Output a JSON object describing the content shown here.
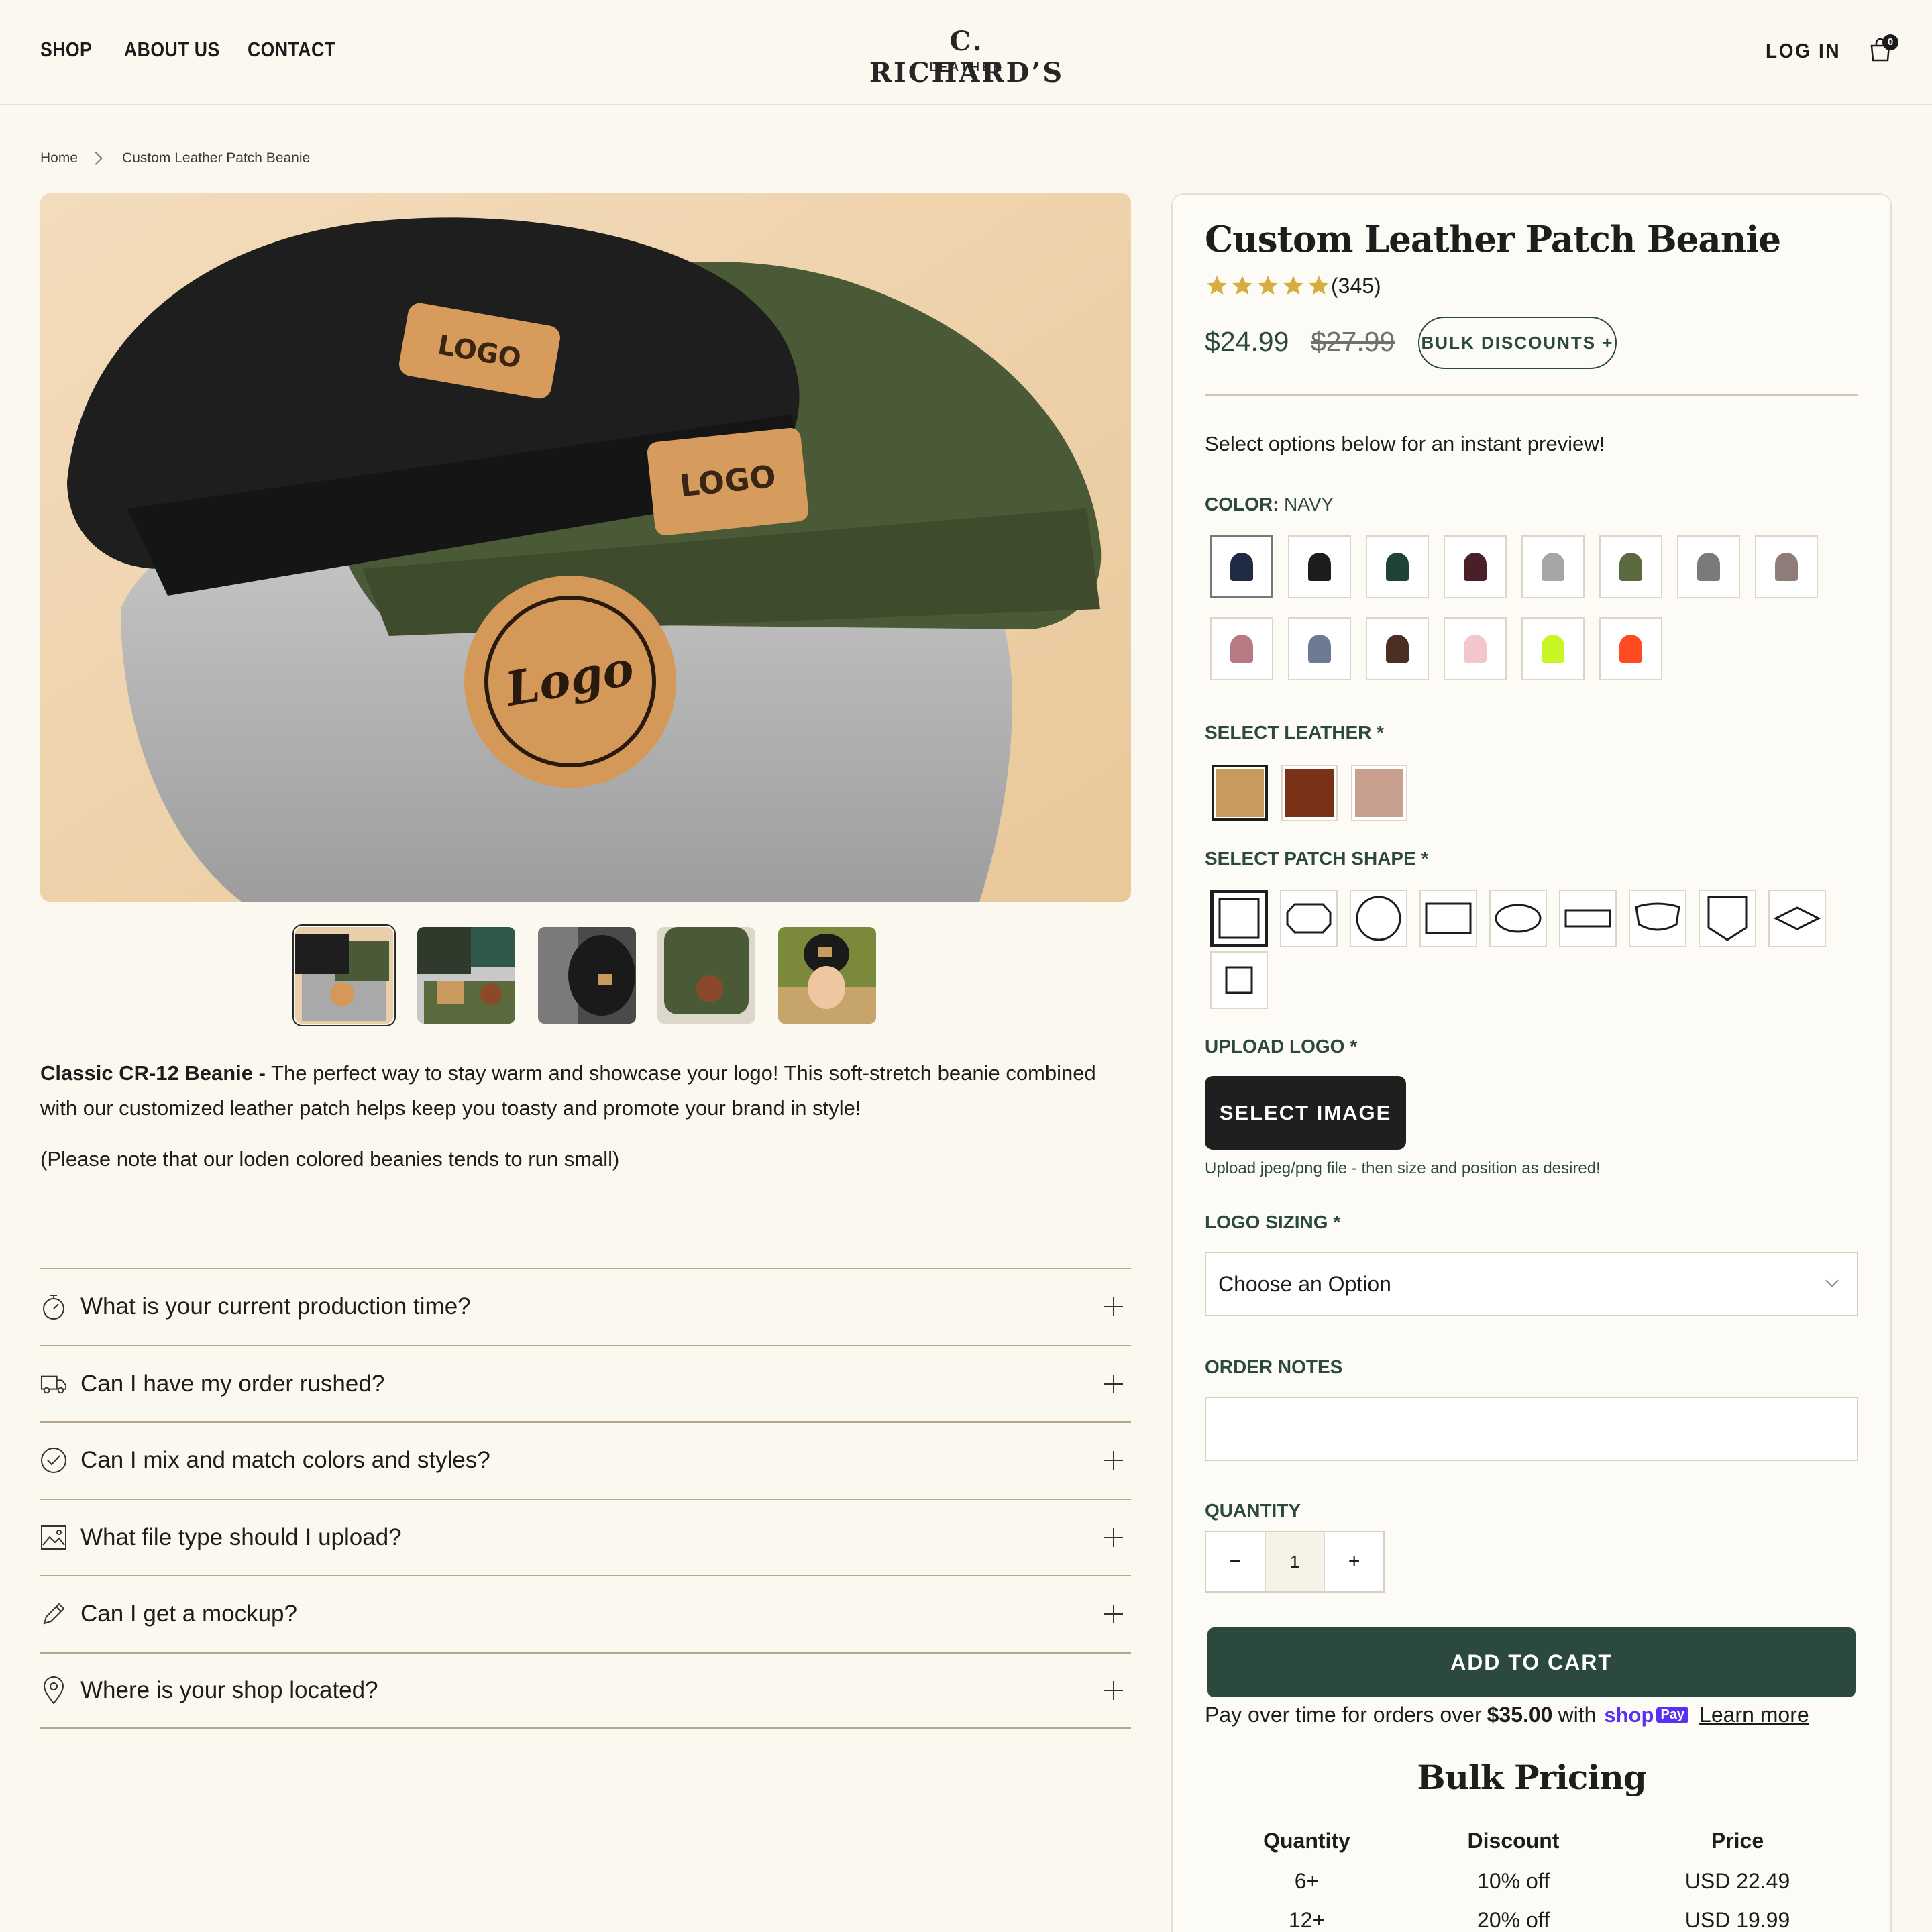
{
  "header": {
    "nav": [
      "SHOP",
      "ABOUT US",
      "CONTACT"
    ],
    "logo_main": "C. RICHARD’S",
    "logo_sub": "LEATHER",
    "login": "LOG IN",
    "cart_count": "0"
  },
  "breadcrumb": {
    "home": "Home",
    "current": "Custom Leather Patch Beanie"
  },
  "description": {
    "bold": "Classic CR-12 Beanie -",
    "text": " The perfect way to stay warm and showcase your logo!  This soft-stretch beanie combined with our customized leather patch helps keep you toasty and promote your brand in style!",
    "note": "(Please note that our loden colored beanies tends to run small)"
  },
  "faq": [
    {
      "icon": "stopwatch-icon",
      "question": "What is your current production time?"
    },
    {
      "icon": "truck-icon",
      "question": "Can I have my order rushed?"
    },
    {
      "icon": "check-circle-icon",
      "question": "Can I mix and match colors and styles?"
    },
    {
      "icon": "image-icon",
      "question": "What file type should I upload?"
    },
    {
      "icon": "pencil-icon",
      "question": "Can I get a mockup?"
    },
    {
      "icon": "map-pin-icon",
      "question": "Where is your shop located?"
    }
  ],
  "product": {
    "title": "Custom Leather Patch Beanie",
    "rating": 5,
    "rating_count": "(345)",
    "price": "$24.99",
    "compare_price": "$27.99",
    "bulk_button": "BULK DISCOUNTS +",
    "preview_text": "Select options below for an instant preview!",
    "color_label": "COLOR:",
    "color_value": "NAVY",
    "colors": [
      "#1f2a44",
      "#1c1c1c",
      "#1f4436",
      "#4a1f27",
      "#a6a6a6",
      "#5a6a3e",
      "#7a7a7a",
      "#8e7c7a",
      "#b87a82",
      "#6c7a94",
      "#4a2f22",
      "#f3c6cb",
      "#c8f525",
      "#ff4a22"
    ],
    "leather_label": "SELECT LEATHER *",
    "leathers": [
      "#c99a5e",
      "#7a3216",
      "#c9a090"
    ],
    "shape_label": "SELECT PATCH SHAPE *",
    "upload_label": "UPLOAD LOGO *",
    "upload_button": "SELECT IMAGE",
    "upload_help": "Upload jpeg/png file - then size and position as desired!",
    "sizing_label": "LOGO SIZING *",
    "sizing_value": "Choose an Option",
    "notes_label": "ORDER NOTES",
    "quantity_label": "QUANTITY",
    "quantity": "1",
    "minus": "−",
    "plus": "+",
    "add_to_cart": "ADD TO CART",
    "pay_prefix": "Pay over time for orders over",
    "pay_amount": "$35.00",
    "pay_with": "with",
    "shop_logo": "shop",
    "shop_pay": "Pay",
    "learn_more": "Learn more"
  },
  "bulk_pricing": {
    "title": "Bulk Pricing",
    "headers": [
      "Quantity",
      "Discount",
      "Price"
    ],
    "rows": [
      [
        "6+",
        "10% off",
        "USD 22.49"
      ],
      [
        "12+",
        "20% off",
        "USD 19.99"
      ]
    ]
  }
}
